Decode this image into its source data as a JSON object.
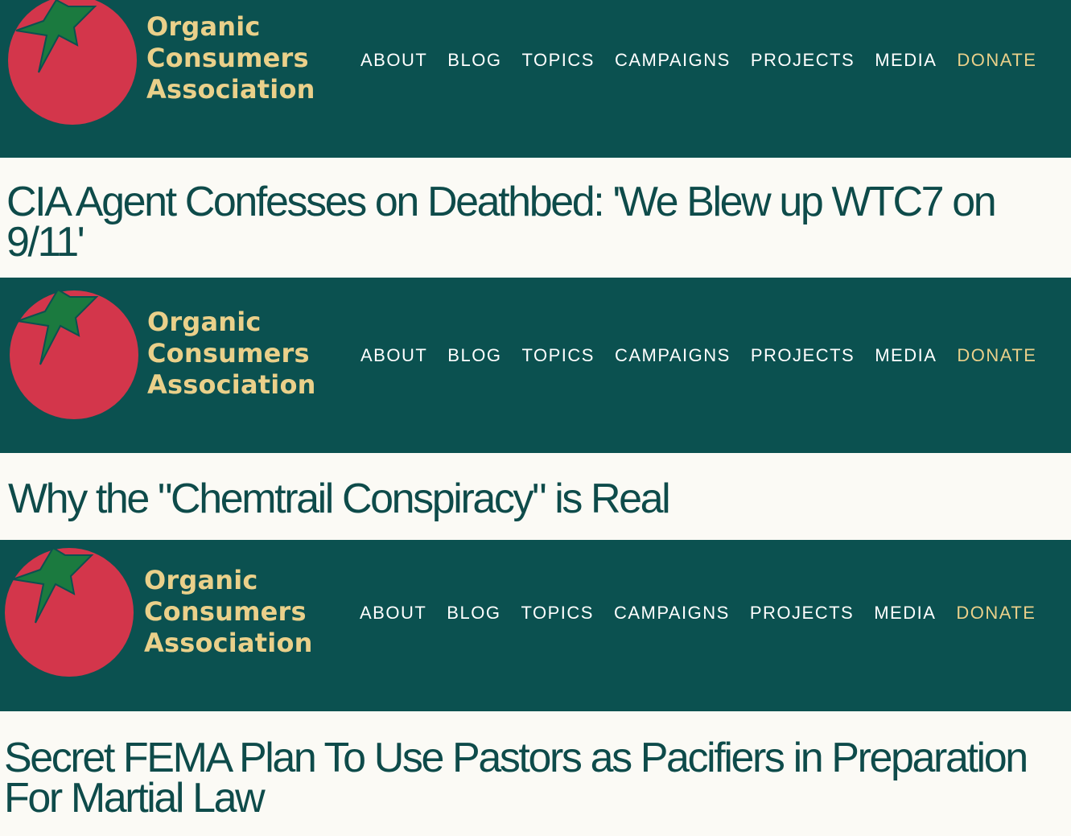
{
  "colors": {
    "header_bg": "#0b5150",
    "accent_gold": "#ead08a",
    "tomato_red": "#d3364b",
    "leaf_green": "#1b7a3f",
    "headline_text": "#0e4b4a",
    "page_bg": "#fbfaf5"
  },
  "logo": {
    "line1": "Organic",
    "line2": "Consumers",
    "line3": "Association",
    "icon": "tomato-star-icon"
  },
  "nav": {
    "about": "ABOUT",
    "blog": "BLOG",
    "topics": "TOPICS",
    "campaigns": "CAMPAIGNS",
    "projects": "PROJECTS",
    "media": "MEDIA",
    "donate": "DONATE"
  },
  "panels": [
    {
      "headline": "CIA Agent Confesses on Deathbed: 'We Blew up WTC7 on 9/11'"
    },
    {
      "headline": "Why the \"Chemtrail Conspiracy\" is Real"
    },
    {
      "headline": "Secret FEMA Plan To Use Pastors as Pacifiers in Preparation For Martial Law"
    }
  ]
}
